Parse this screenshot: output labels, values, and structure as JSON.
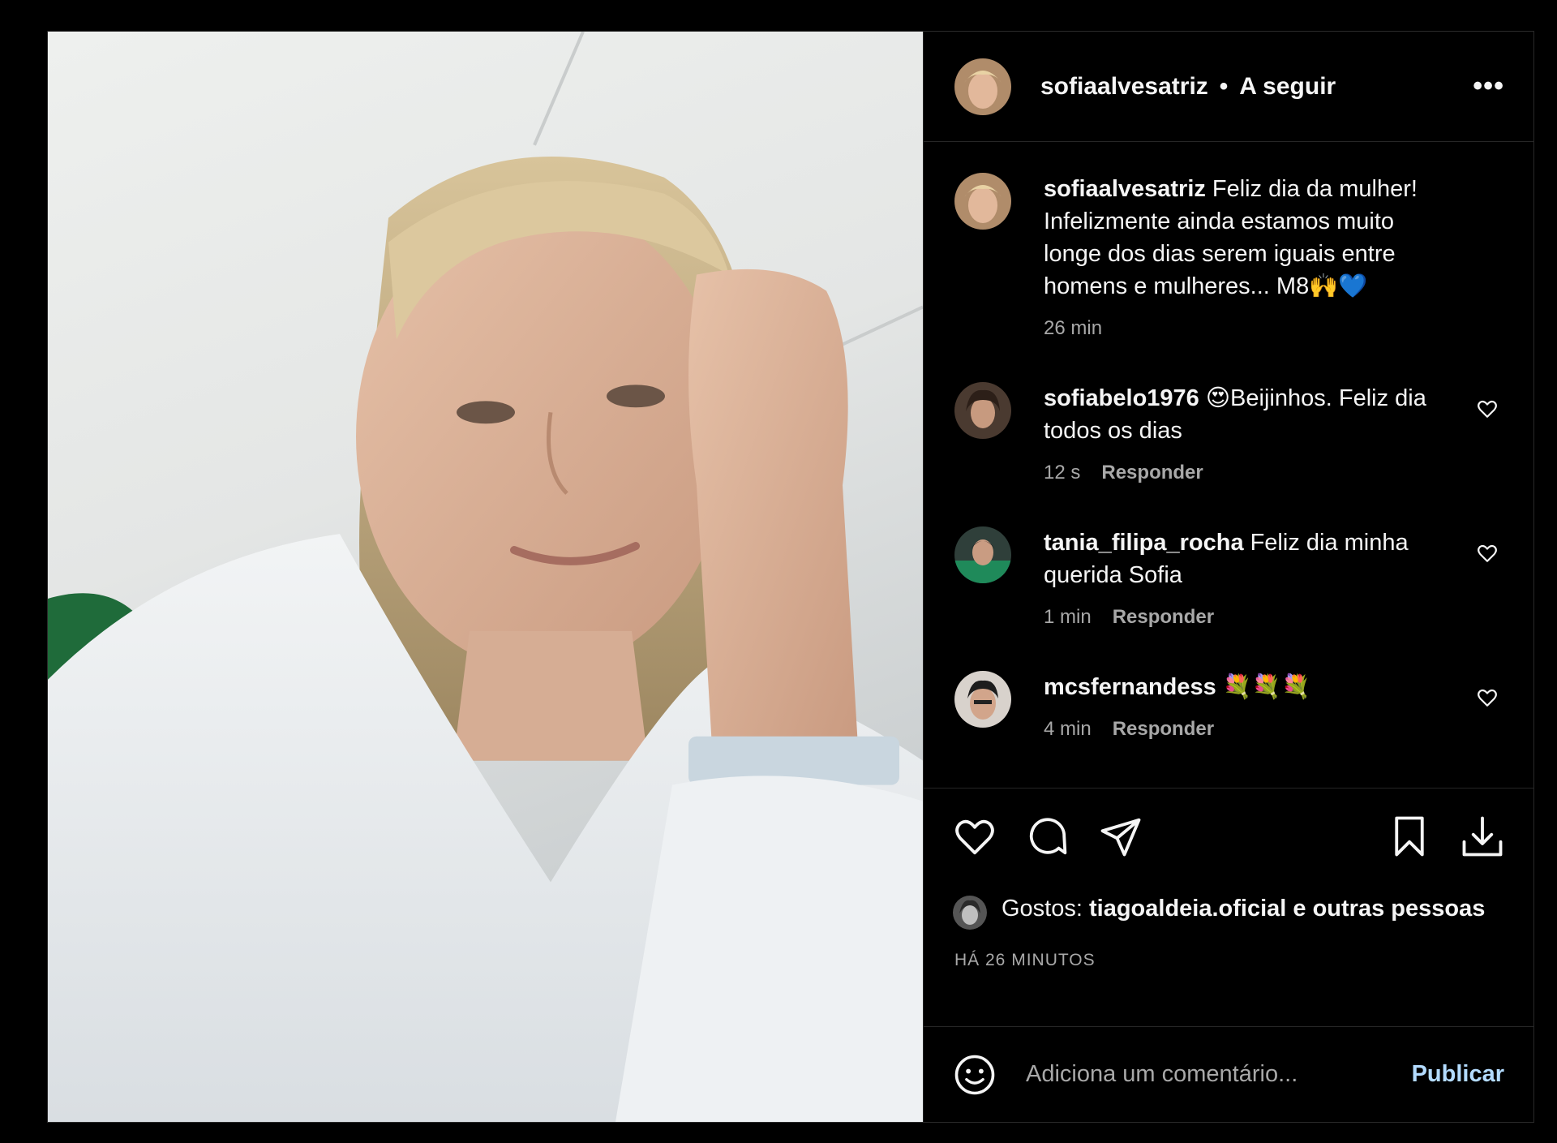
{
  "post": {
    "author": "sofiaalvesatriz",
    "separator": "•",
    "follow_label": "A seguir",
    "more_label": "•••",
    "caption": {
      "username": "sofiaalvesatriz",
      "text": "Feliz dia da mulher! Infelizmente ainda estamos muito longe dos dias serem iguais entre homens e mulheres... M8🙌💙",
      "time": "26 min"
    },
    "comments": [
      {
        "username": "sofiabelo1976",
        "text": "😍Beijinhos. Feliz dia todos os dias",
        "time": "12 s",
        "reply": "Responder"
      },
      {
        "username": "tania_filipa_rocha",
        "text": "Feliz dia minha querida Sofia",
        "time": "1 min",
        "reply": "Responder"
      },
      {
        "username": "mcsfernandess",
        "text": "💐💐💐",
        "time": "4 min",
        "reply": "Responder"
      }
    ],
    "likes": {
      "prefix": "Gostos: ",
      "user": "tiagoaldeia.oficial",
      "suffix": " e outras pessoas"
    },
    "timestamp": "HÁ 26 MINUTOS",
    "add_comment": {
      "placeholder": "Adiciona um comentário...",
      "publish_label": "Publicar"
    }
  },
  "icons": {
    "like": "heart-icon",
    "comment": "comment-icon",
    "share": "paper-plane-icon",
    "save": "bookmark-icon",
    "download": "download-icon",
    "emoji": "smiley-icon",
    "more": "more-icon"
  },
  "colors": {
    "background": "#000000",
    "text": "#f5f5f5",
    "muted": "#a8a8a8",
    "publish": "#b3dbff",
    "divider": "#262626"
  }
}
